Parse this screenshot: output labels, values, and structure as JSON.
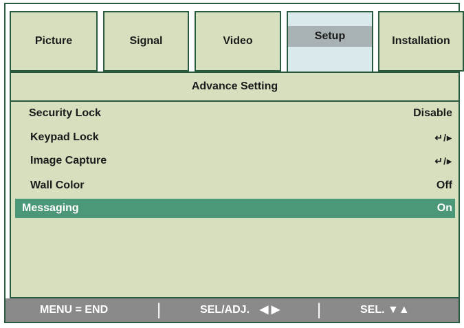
{
  "tabs": [
    {
      "label": "Picture"
    },
    {
      "label": "Signal"
    },
    {
      "label": "Video"
    },
    {
      "label": "Setup",
      "active": true
    },
    {
      "label": "Installation"
    }
  ],
  "panel": {
    "title": "Advance Setting",
    "rows": [
      {
        "label": "Security Lock",
        "value": "Disable"
      },
      {
        "label": "Keypad Lock",
        "value": "↵/▸"
      },
      {
        "label": "Image Capture",
        "value": "↵/▸"
      },
      {
        "label": "Wall Color",
        "value": "Off"
      },
      {
        "label": "Messaging",
        "value": "On",
        "selected": true
      }
    ]
  },
  "footer": {
    "menu_hint": "MENU = END",
    "adjust_hint": "SEL/ADJ.",
    "adjust_icons": "◀ ▶",
    "select_hint": "SEL.",
    "select_icons": "▼▲",
    "separator": "|"
  },
  "colors": {
    "panel_bg": "#d6e0bf",
    "active_tab_bg": "#dae9ec",
    "selected_row_bg": "#4a9877",
    "border": "#2a5a3f",
    "footer_bg": "#8a8a8a"
  }
}
